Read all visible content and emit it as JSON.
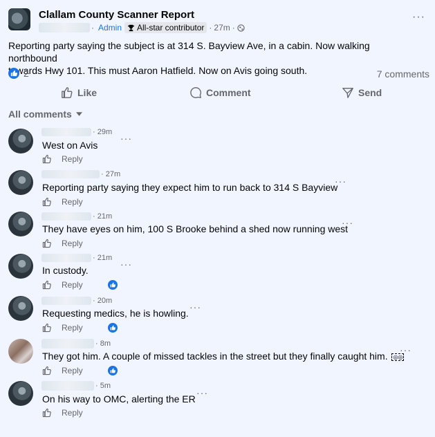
{
  "post": {
    "group_name": "Clallam County Scanner Report",
    "role": "Admin",
    "badge": "All-star contributor",
    "time": "27m",
    "separator": "·",
    "text_line1": "Reporting party saying the subject is at 314 S. Bayview Ave, in a cabin. Now walking northbound",
    "text_line2": "towards Hwy 101. This must Aaron Hatfield.  Now on Avis going south.",
    "reaction_count": "2",
    "comments_count": "7 comments",
    "more": "···"
  },
  "actions": {
    "like": "Like",
    "comment": "Comment",
    "send": "Send"
  },
  "comments_header": "All comments",
  "comments": [
    {
      "time": "· 29m",
      "text": "West on Avis",
      "reply": "Reply",
      "liked": false
    },
    {
      "time": "· 27m",
      "text": "Reporting party saying they expect him to run back to 314 S Bayview",
      "reply": "Reply",
      "liked": false
    },
    {
      "time": "· 21m",
      "text": "They have eyes on him, 100 S Brooke behind a shed now running west",
      "reply": "Reply",
      "liked": false
    },
    {
      "time": "· 21m",
      "text": "In custody.",
      "reply": "Reply",
      "liked": true
    },
    {
      "time": "· 20m",
      "text": "Requesting medics, he is howling.",
      "reply": "Reply",
      "liked": true
    },
    {
      "time": "· 8m",
      "text": "They got him. A couple of missed tackles in the street but they finally caught him.",
      "reply": "Reply",
      "liked": true
    },
    {
      "time": "· 5m",
      "text": "On his way to OMC, alerting the ER",
      "reply": "Reply",
      "liked": false
    }
  ],
  "colors": {
    "accent": "#1b74e4",
    "background": "#f0f5ff",
    "muted": "#65676b"
  }
}
